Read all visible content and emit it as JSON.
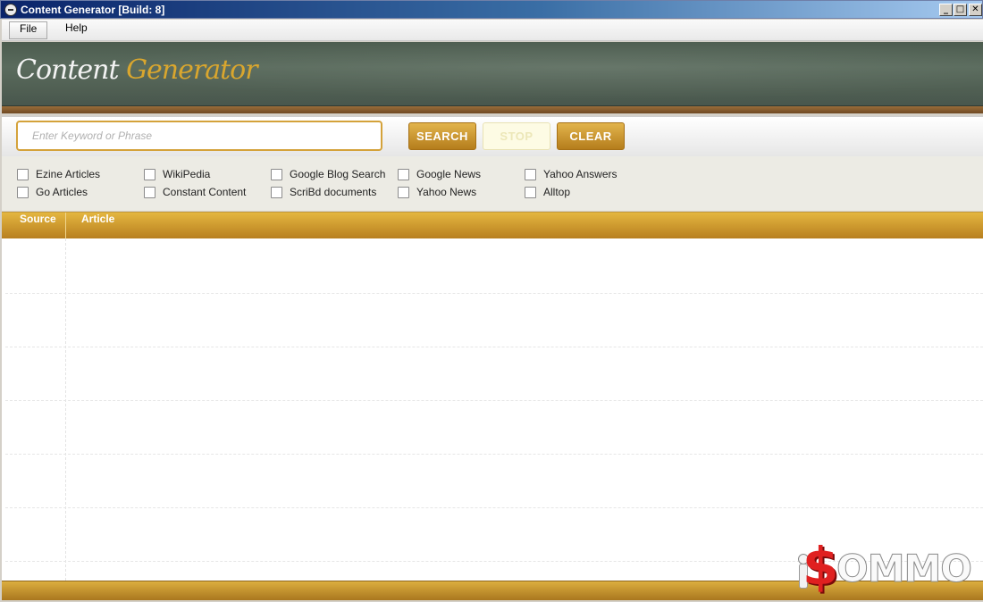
{
  "window": {
    "title": "Content Generator [Build: 8]",
    "controls": {
      "minimize": "_",
      "maximize": "□",
      "close": "✕"
    }
  },
  "menu": {
    "items": [
      "File",
      "Help"
    ]
  },
  "banner": {
    "logo_word1": "Content",
    "logo_word2": "Generator"
  },
  "search": {
    "placeholder": "Enter Keyword or Phrase",
    "value": "",
    "search_label": "SEARCH",
    "stop_label": "STOP",
    "clear_label": "CLEAR"
  },
  "sources": [
    {
      "label": "Ezine Articles",
      "checked": false
    },
    {
      "label": "Go Articles",
      "checked": false
    },
    {
      "label": "WikiPedia",
      "checked": false
    },
    {
      "label": "Constant Content",
      "checked": false
    },
    {
      "label": "Google Blog Search",
      "checked": false
    },
    {
      "label": "ScriBd documents",
      "checked": false
    },
    {
      "label": "Google News",
      "checked": false
    },
    {
      "label": "Yahoo News",
      "checked": false
    },
    {
      "label": "Yahoo Answers",
      "checked": false
    },
    {
      "label": "Alltop",
      "checked": false
    }
  ],
  "table": {
    "columns": [
      "Source",
      "Article"
    ],
    "rows": []
  },
  "watermark": {
    "text_symbol": "$",
    "text": "OMMO"
  },
  "colors": {
    "accent_gold": "#d4a23a",
    "header_gold": "#e4b640",
    "banner_green": "#4c5c4f",
    "logo_gold": "#d9a62e",
    "stop_disabled": "#fdfbe4"
  }
}
